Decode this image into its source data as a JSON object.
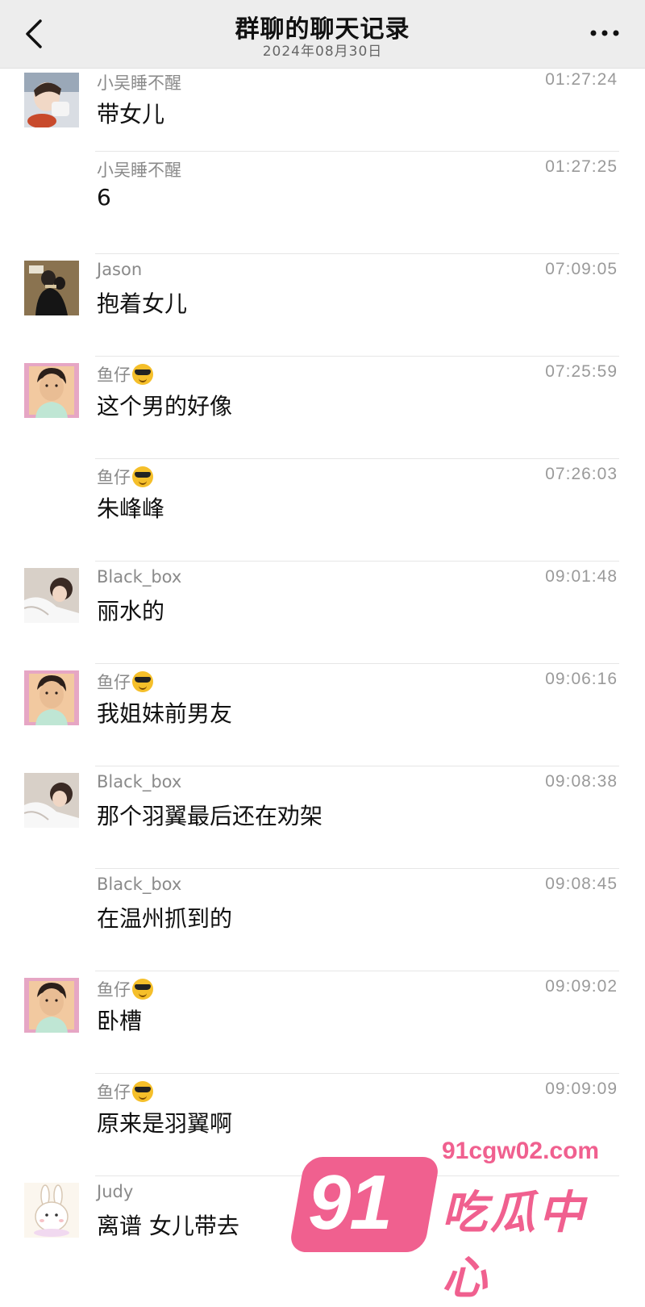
{
  "header": {
    "title": "群聊的聊天记录",
    "subtitle": "2024年08月30日"
  },
  "messages": [
    {
      "sender": "小吴睡不醒",
      "time": "01:27:24",
      "text": "带女儿",
      "avatar": "avatar-boy-eating"
    },
    {
      "sender": "小吴睡不醒",
      "time": "01:27:25",
      "text": "6",
      "avatar": null
    },
    {
      "sender": "Jason",
      "time": "07:09:05",
      "text": "抱着女儿",
      "avatar": "avatar-couple"
    },
    {
      "sender": "鱼仔",
      "emoji": "sunglasses",
      "time": "07:25:59",
      "text": "这个男的好像",
      "avatar": "avatar-boy-portrait"
    },
    {
      "sender": "鱼仔",
      "emoji": "sunglasses",
      "time": "07:26:03",
      "text": "朱峰峰",
      "avatar": null
    },
    {
      "sender": "Black_box",
      "time": "09:01:48",
      "text": "丽水的",
      "avatar": "avatar-girl-lying"
    },
    {
      "sender": "鱼仔",
      "emoji": "sunglasses",
      "time": "09:06:16",
      "text": "我姐妹前男友",
      "avatar": "avatar-boy-portrait"
    },
    {
      "sender": "Black_box",
      "time": "09:08:38",
      "text": "那个羽翼最后还在劝架",
      "avatar": "avatar-girl-lying"
    },
    {
      "sender": "Black_box",
      "time": "09:08:45",
      "text": "在温州抓到的",
      "avatar": null
    },
    {
      "sender": "鱼仔",
      "emoji": "sunglasses",
      "time": "09:09:02",
      "text": "卧槽",
      "avatar": "avatar-boy-portrait"
    },
    {
      "sender": "鱼仔",
      "emoji": "sunglasses",
      "time": "09:09:09",
      "text": "原来是羽翼啊",
      "avatar": null
    },
    {
      "sender": "Judy",
      "time": "",
      "text": "离谱  女儿带去",
      "avatar": "avatar-bunny"
    }
  ],
  "watermark": {
    "logo": "91",
    "domain": "91cgw02.com",
    "name": "吃瓜中心"
  },
  "colors": {
    "header_bg": "#ededed",
    "divider": "#e6e6e6",
    "watermark_pink": "#f0608f"
  }
}
